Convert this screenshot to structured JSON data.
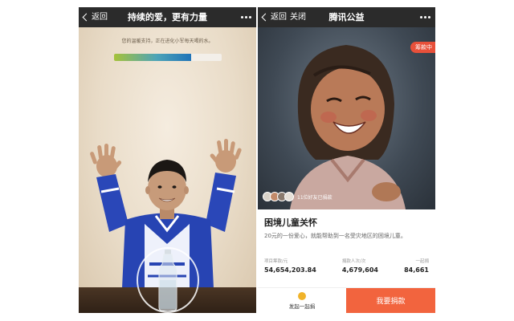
{
  "left_screen": {
    "nav": {
      "back_label": "返回",
      "title": "持续的爱，更有力量"
    },
    "caption": "您的温暖支持，正在进化小军每天喝的水。",
    "progress": {
      "fraction": 0.72
    }
  },
  "right_screen": {
    "nav": {
      "back_label": "返回",
      "close_label": "关闭",
      "title": "腾讯公益"
    },
    "status_tag": "筹款中",
    "friends_text": "11位好友已捐款",
    "project": {
      "title": "困境儿童关怀",
      "description": "20元的一份爱心，就能帮助到一名受灾地区的困境儿童。"
    },
    "stats": [
      {
        "label": "项目筹款/元",
        "value": "54,654,203.84"
      },
      {
        "label": "捐款人次/次",
        "value": "4,679,604"
      },
      {
        "label": "一起捐",
        "value": "84,661"
      }
    ],
    "bottom": {
      "team_label": "发起一起捐",
      "donate_label": "我要捐款"
    }
  },
  "colors": {
    "nav_bg": "#2b2b2b",
    "donate_orange": "#f2643e",
    "status_red": "#e8503a"
  },
  "icons": [
    "chevron-left-icon",
    "more-dots-icon",
    "team-donate-icon"
  ]
}
